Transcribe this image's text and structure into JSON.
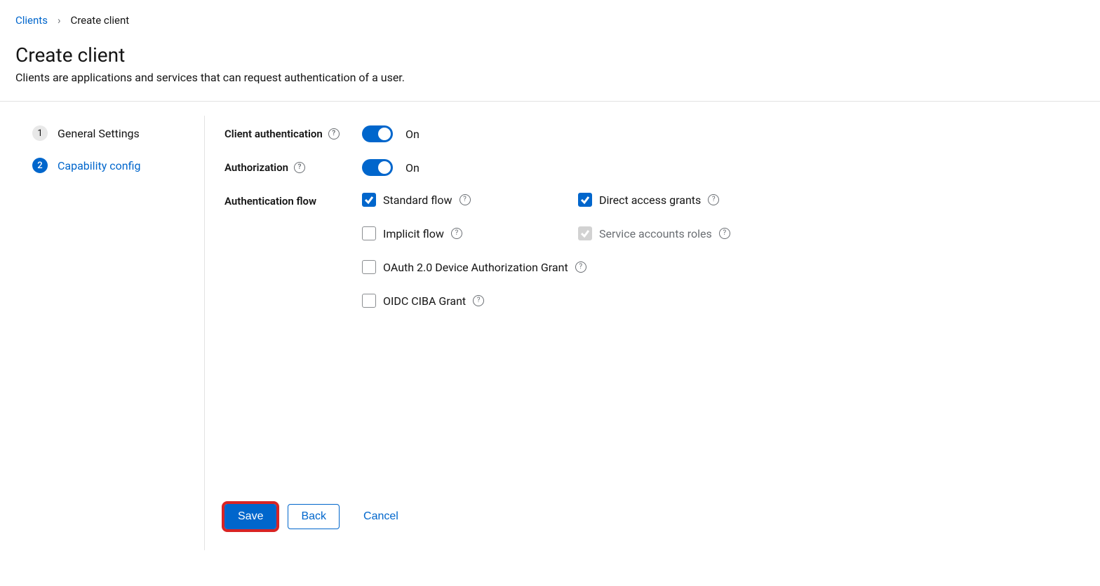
{
  "breadcrumb": {
    "root": "Clients",
    "current": "Create client"
  },
  "page": {
    "title": "Create client",
    "subtitle": "Clients are applications and services that can request authentication of a user."
  },
  "stepper": {
    "steps": [
      {
        "num": "1",
        "label": "General Settings",
        "active": false
      },
      {
        "num": "2",
        "label": "Capability config",
        "active": true
      }
    ]
  },
  "form": {
    "client_auth": {
      "label": "Client authentication",
      "state": "On"
    },
    "authorization": {
      "label": "Authorization",
      "state": "On"
    },
    "auth_flow": {
      "label": "Authentication flow",
      "items": {
        "standard": "Standard flow",
        "direct": "Direct access grants",
        "implicit": "Implicit flow",
        "service": "Service accounts roles",
        "device": "OAuth 2.0 Device Authorization Grant",
        "ciba": "OIDC CIBA Grant"
      }
    }
  },
  "buttons": {
    "save": "Save",
    "back": "Back",
    "cancel": "Cancel"
  }
}
